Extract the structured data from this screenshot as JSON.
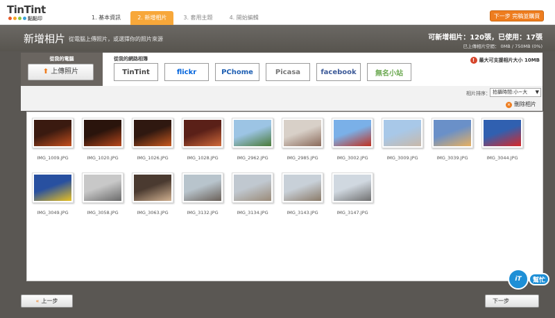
{
  "brand": {
    "name": "TinTint",
    "sub": "點點印",
    "dot_colors": [
      "#e85a2a",
      "#f5a623",
      "#8cc63f",
      "#3aa2d8"
    ]
  },
  "steps": [
    {
      "label": "1. 基本資訊",
      "state": "done"
    },
    {
      "label": "2. 新增相片",
      "state": "active"
    },
    {
      "label": "3. 套用主題",
      "state": "todo"
    },
    {
      "label": "4. 開始編輯",
      "state": "todo"
    }
  ],
  "header": {
    "next_label": "下一步 完稿並購買",
    "title": "新增相片",
    "subtitle": "從電腦上傳照片，或選擇你的照片來源",
    "quota": "可新增相片：120張，已使用：17張",
    "space": "已上傳相片空間： 0MB / 750MB (0%)"
  },
  "sources": {
    "local_label": "從我的電腦",
    "upload_label": "上傳照片",
    "online_label": "從我的網路相簿",
    "max_size": "最大可支援相片大小 10MB",
    "services": [
      {
        "label": "TinTint",
        "color": "#444444"
      },
      {
        "label": "flickr",
        "color": "#0063dc"
      },
      {
        "label": "PChome",
        "color": "#1e5fb3"
      },
      {
        "label": "Picasa",
        "color": "#777777"
      },
      {
        "label": "facebook",
        "color": "#3b5998"
      },
      {
        "label": "無名小站",
        "color": "#6aa84f"
      }
    ]
  },
  "toolbar": {
    "sort_label": "相片排序：",
    "sort_value": "拍攝時間:小~大",
    "delete_label": "刪除相片"
  },
  "photos": [
    {
      "name": "IMG_1009.JPG",
      "c1": "#3a1a10",
      "c2": "#c4501e"
    },
    {
      "name": "IMG_1020.JPG",
      "c1": "#2a140c",
      "c2": "#b8481c"
    },
    {
      "name": "IMG_1026.JPG",
      "c1": "#2f1810",
      "c2": "#c85a20"
    },
    {
      "name": "IMG_1028.JPG",
      "c1": "#5a2018",
      "c2": "#d06a3a"
    },
    {
      "name": "IMG_2962.JPG",
      "c1": "#9cc4e4",
      "c2": "#4a7a38"
    },
    {
      "name": "IMG_2985.JPG",
      "c1": "#d8d0c8",
      "c2": "#8a6a5a"
    },
    {
      "name": "IMG_3002.JPG",
      "c1": "#7ab0e8",
      "c2": "#c03020"
    },
    {
      "name": "IMG_3009.JPG",
      "c1": "#a8c8e8",
      "c2": "#c8b8a8"
    },
    {
      "name": "IMG_3039.JPG",
      "c1": "#6a90c8",
      "c2": "#e8b060"
    },
    {
      "name": "IMG_3044.JPG",
      "c1": "#3060b0",
      "c2": "#d82828"
    },
    {
      "name": "IMG_3049.JPG",
      "c1": "#2850a0",
      "c2": "#e8c020"
    },
    {
      "name": "IMG_3058.JPG",
      "c1": "#c8c8c8",
      "c2": "#6a6a6a"
    },
    {
      "name": "IMG_3063.JPG",
      "c1": "#4a3a30",
      "c2": "#d0b090"
    },
    {
      "name": "IMG_3132.JPG",
      "c1": "#b8c4cc",
      "c2": "#6a6058"
    },
    {
      "name": "IMG_3134.JPG",
      "c1": "#c0c8d0",
      "c2": "#9a8a78"
    },
    {
      "name": "IMG_3143.JPG",
      "c1": "#c8d0d8",
      "c2": "#8a7a68"
    },
    {
      "name": "IMG_3147.JPG",
      "c1": "#d0d8e0",
      "c2": "#707070"
    }
  ],
  "footer": {
    "prev_label": "上一步",
    "next_label": "下一步",
    "badge_circle": "iT",
    "badge_text": "幫忙"
  }
}
